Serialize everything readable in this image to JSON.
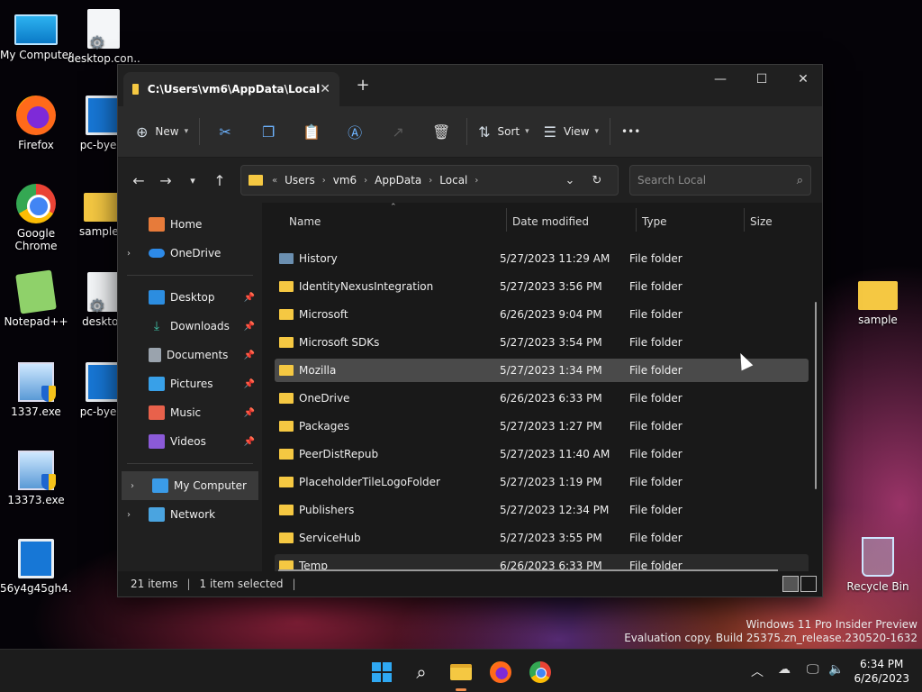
{
  "desktop": {
    "icons": [
      {
        "label": "My Computer",
        "icon": "computer-icon"
      },
      {
        "label": "desktop.con...",
        "icon": "settings-file-icon"
      },
      {
        "label": "Firefox",
        "icon": "firefox-icon"
      },
      {
        "label": "pc-bye-b",
        "icon": "window-file-icon"
      },
      {
        "label": "Google Chrome",
        "icon": "chrome-icon"
      },
      {
        "label": "sample.c",
        "icon": "zip-folder-icon"
      },
      {
        "label": "Notepad++",
        "icon": "notepad-icon"
      },
      {
        "label": "desktop",
        "icon": "settings-file-icon"
      },
      {
        "label": "1337.exe",
        "icon": "exe-icon"
      },
      {
        "label": "pc-bye-b",
        "icon": "window-file-icon"
      },
      {
        "label": "13373.exe",
        "icon": "exe-icon"
      },
      {
        "label": "56y4g45gh4...",
        "icon": "window-file-icon"
      },
      {
        "label": "sample",
        "icon": "folder-icon"
      },
      {
        "label": "Recycle Bin",
        "icon": "recycle-bin-icon"
      }
    ]
  },
  "window": {
    "tab_title": "C:\\Users\\vm6\\AppData\\Local",
    "toolbar": {
      "new_label": "New",
      "sort_label": "Sort",
      "view_label": "View",
      "more_label": "•••"
    },
    "address": {
      "overflow": "«",
      "crumbs": [
        "Users",
        "vm6",
        "AppData",
        "Local"
      ]
    },
    "search": {
      "placeholder": "Search Local"
    },
    "sidebar": {
      "items": [
        {
          "label": "Home"
        },
        {
          "label": "OneDrive"
        },
        {
          "label": "Desktop"
        },
        {
          "label": "Downloads"
        },
        {
          "label": "Documents"
        },
        {
          "label": "Pictures"
        },
        {
          "label": "Music"
        },
        {
          "label": "Videos"
        },
        {
          "label": "My Computer"
        },
        {
          "label": "Network"
        }
      ]
    },
    "columns": {
      "name": "Name",
      "date": "Date modified",
      "type": "Type",
      "size": "Size"
    },
    "files": [
      {
        "name": "History",
        "date": "5/27/2023 11:29 AM",
        "type": "File folder"
      },
      {
        "name": "IdentityNexusIntegration",
        "date": "5/27/2023 3:56 PM",
        "type": "File folder"
      },
      {
        "name": "Microsoft",
        "date": "6/26/2023 9:04 PM",
        "type": "File folder"
      },
      {
        "name": "Microsoft SDKs",
        "date": "5/27/2023 3:54 PM",
        "type": "File folder"
      },
      {
        "name": "Mozilla",
        "date": "5/27/2023 1:34 PM",
        "type": "File folder"
      },
      {
        "name": "OneDrive",
        "date": "6/26/2023 6:33 PM",
        "type": "File folder"
      },
      {
        "name": "Packages",
        "date": "5/27/2023 1:27 PM",
        "type": "File folder"
      },
      {
        "name": "PeerDistRepub",
        "date": "5/27/2023 11:40 AM",
        "type": "File folder"
      },
      {
        "name": "PlaceholderTileLogoFolder",
        "date": "5/27/2023 1:19 PM",
        "type": "File folder"
      },
      {
        "name": "Publishers",
        "date": "5/27/2023 12:34 PM",
        "type": "File folder"
      },
      {
        "name": "ServiceHub",
        "date": "5/27/2023 3:55 PM",
        "type": "File folder"
      },
      {
        "name": "Temp",
        "date": "6/26/2023 6:33 PM",
        "type": "File folder"
      }
    ],
    "status": {
      "count": "21 items",
      "selected": "1 item selected"
    }
  },
  "watermark": {
    "line1": "Windows 11 Pro Insider Preview",
    "line2": "Evaluation copy. Build 25375.zn_release.230520-1632"
  },
  "taskbar": {
    "time": "6:34 PM",
    "date": "6/26/2023"
  },
  "colors": {
    "folder": "#f5c842",
    "accent": "#2fa8f2"
  }
}
